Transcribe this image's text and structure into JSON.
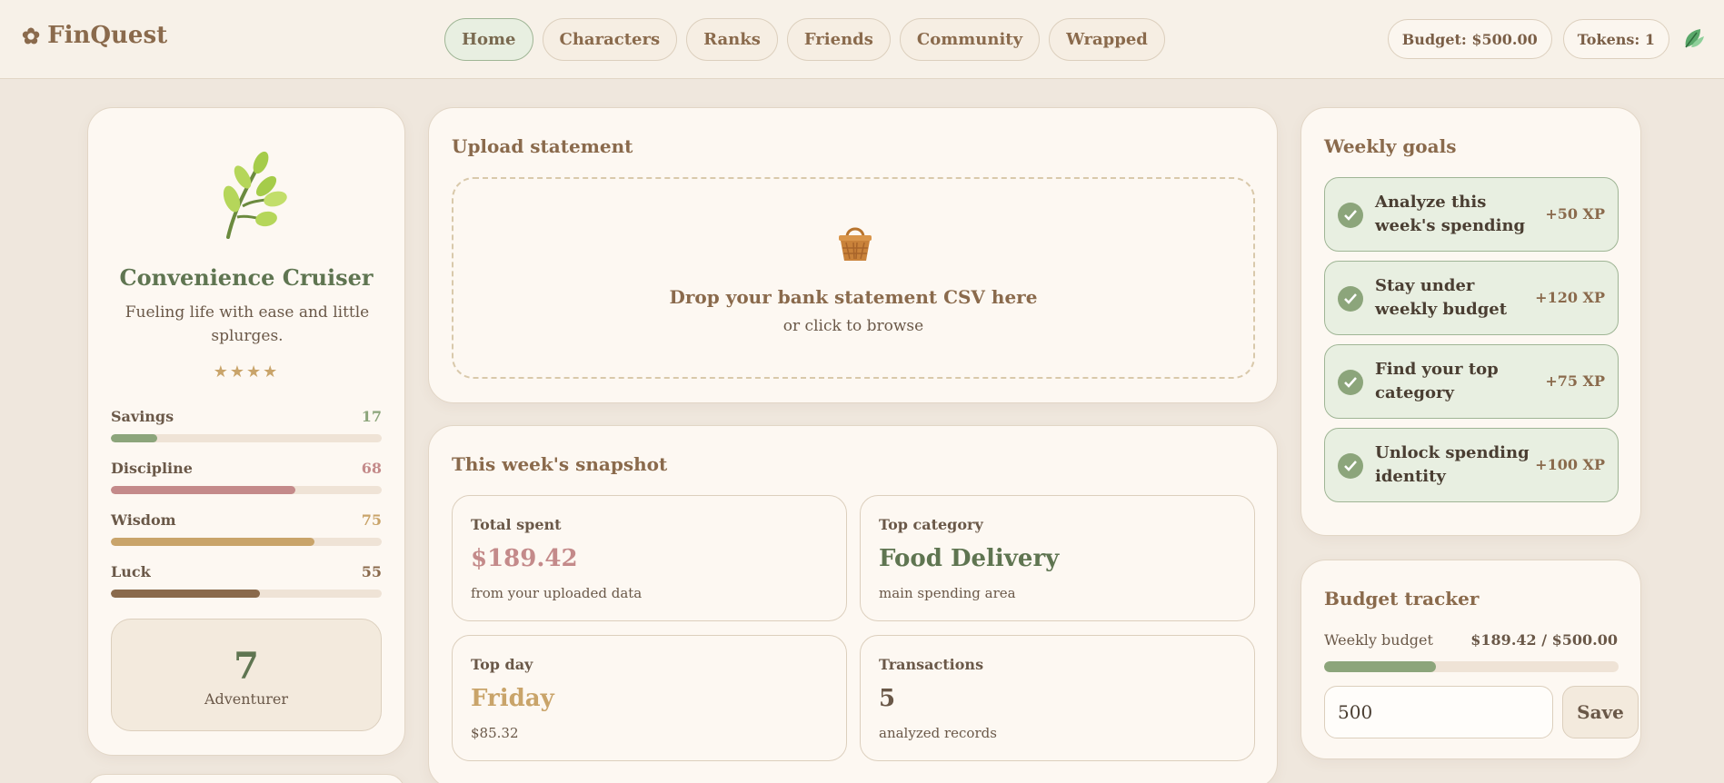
{
  "header": {
    "brand": "FinQuest",
    "nav": [
      "Home",
      "Characters",
      "Ranks",
      "Friends",
      "Community",
      "Wrapped"
    ],
    "active_nav": "Home",
    "budget_pill": "Budget: $500.00",
    "tokens_pill": "Tokens: 1"
  },
  "profile": {
    "name": "Convenience Cruiser",
    "description": "Fueling life with ease and little splurges.",
    "stars": "★★★★",
    "stats": [
      {
        "label": "Savings",
        "value": "17",
        "percent": 17,
        "color": "#8ca57b"
      },
      {
        "label": "Discipline",
        "value": "68",
        "percent": 68,
        "color": "#c48a8a"
      },
      {
        "label": "Wisdom",
        "value": "75",
        "percent": 75,
        "color": "#c9a46a"
      },
      {
        "label": "Luck",
        "value": "55",
        "percent": 55,
        "color": "#8a6a4c"
      }
    ],
    "level": "7",
    "level_title": "Adventurer"
  },
  "upload": {
    "title": "Upload statement",
    "drop_title": "Drop your bank statement CSV here",
    "drop_sub": "or click to browse"
  },
  "snapshot": {
    "title": "This week's snapshot",
    "tiles": [
      {
        "label": "Total spent",
        "value": "$189.42",
        "sub": "from your uploaded data",
        "color": "#c48a8a"
      },
      {
        "label": "Top category",
        "value": "Food Delivery",
        "sub": "main spending area",
        "color": "#5f7551"
      },
      {
        "label": "Top day",
        "value": "Friday",
        "sub": "$85.32",
        "color": "#c9a46a"
      },
      {
        "label": "Transactions",
        "value": "5",
        "sub": "analyzed records",
        "color": "#6a5848"
      }
    ]
  },
  "goals": {
    "title": "Weekly goals",
    "items": [
      {
        "text": "Analyze this week's spending",
        "xp": "+50 XP"
      },
      {
        "text": "Stay under weekly budget",
        "xp": "+120 XP"
      },
      {
        "text": "Find your top category",
        "xp": "+75 XP"
      },
      {
        "text": "Unlock spending identity",
        "xp": "+100 XP"
      }
    ]
  },
  "budget": {
    "title": "Budget tracker",
    "label": "Weekly budget",
    "amount": "$189.42 / $500.00",
    "progress": 0.379,
    "input_value": "500",
    "save_label": "Save"
  }
}
